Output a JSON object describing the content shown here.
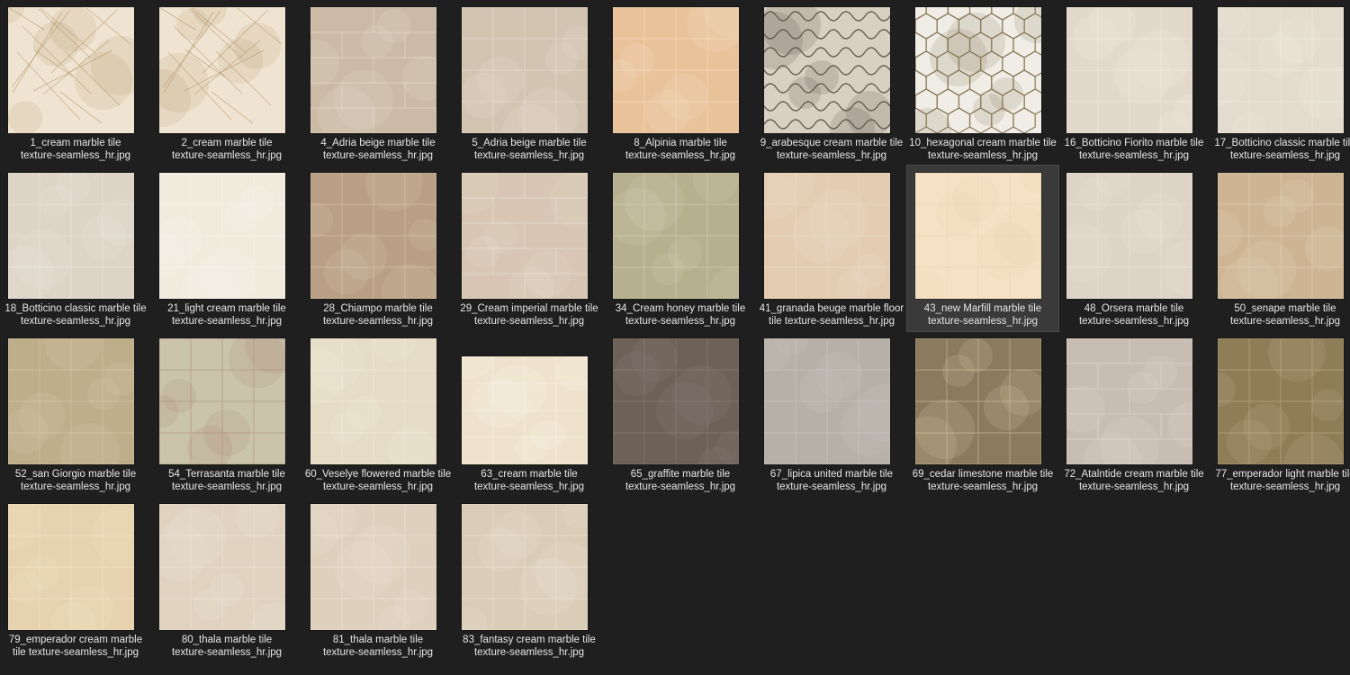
{
  "files": [
    {
      "line1": "1_cream marble tile",
      "line2": "texture-seamless_hr.jpg",
      "base": "#efe4d2",
      "vein": "#b99a6e",
      "pattern": "veins"
    },
    {
      "line1": "2_cream marble tile",
      "line2": "texture-seamless_hr.jpg",
      "base": "#efe4d2",
      "vein": "#b99a6e",
      "pattern": "veins"
    },
    {
      "line1": "4_Adria beige marble tile",
      "line2": "texture-seamless_hr.jpg",
      "base": "#cbbba6",
      "vein": "#e8ddd0",
      "pattern": "brick"
    },
    {
      "line1": "5_Adria beige marble tile",
      "line2": "texture-seamless_hr.jpg",
      "base": "#d2c4b1",
      "vein": "#ece2d6",
      "pattern": "grid"
    },
    {
      "line1": "8_Alpinia marble tile",
      "line2": "texture-seamless_hr.jpg",
      "base": "#e9c29a",
      "vein": "#f6e2cb",
      "pattern": "grid"
    },
    {
      "line1": "9_arabesque cream marble tile",
      "line2": "texture-seamless_hr.jpg",
      "base": "#d8d0c2",
      "vein": "#5a5346",
      "pattern": "arabesque"
    },
    {
      "line1": "10_hexagonal cream marble tile",
      "line2": "texture-seamless_hr.jpg",
      "base": "#f0ede6",
      "vein": "#8a7a5a",
      "pattern": "hex"
    },
    {
      "line1": "16_Botticino Fiorito marble tile",
      "line2": "texture-seamless_hr.jpg",
      "base": "#e2d9cb",
      "vein": "#f4eee5",
      "pattern": "grid"
    },
    {
      "line1": "17_Botticino classic marble tile",
      "line2": "texture-seamless_hr.jpg",
      "base": "#e3dbcd",
      "vein": "#f5efe6",
      "pattern": "grid"
    },
    {
      "line1": "18_Botticino classic marble tile",
      "line2": "texture-seamless_hr.jpg",
      "base": "#ddd4c6",
      "vein": "#f1ebe2",
      "pattern": "grid"
    },
    {
      "line1": "21_light cream marble tile",
      "line2": "texture-seamless_hr.jpg",
      "base": "#f1ebde",
      "vein": "#faf6ef",
      "pattern": "grid"
    },
    {
      "line1": "28_Chiampo marble tile",
      "line2": "texture-seamless_hr.jpg",
      "base": "#b99f86",
      "vein": "#dccbb8",
      "pattern": "grid"
    },
    {
      "line1": "29_Cream imperial marble tile",
      "line2": "texture-seamless_hr.jpg",
      "base": "#d6c6b3",
      "vein": "#ede3d7",
      "pattern": "brick"
    },
    {
      "line1": "34_Cream honey marble tile",
      "line2": "texture-seamless_hr.jpg",
      "base": "#b7b08e",
      "vein": "#d8d3bb",
      "pattern": "grid"
    },
    {
      "line1": "41_granada beuge marble floor",
      "line2": "tile texture-seamless_hr.jpg",
      "base": "#e3ccb2",
      "vein": "#efdfcd",
      "pattern": "grid"
    },
    {
      "line1": "43_new Marfill marble tile",
      "line2": "texture-seamless_hr.jpg",
      "base": "#f5e2c4",
      "vein": "#e9d3b1",
      "pattern": "grid"
    },
    {
      "line1": "48_Orsera marble tile",
      "line2": "texture-seamless_hr.jpg",
      "base": "#ddd3c6",
      "vein": "#eee7de",
      "pattern": "grid"
    },
    {
      "line1": "50_senape marble tile",
      "line2": "texture-seamless_hr.jpg",
      "base": "#cdb593",
      "vein": "#e6d6bf",
      "pattern": "grid"
    },
    {
      "line1": "52_san Giorgio marble tile",
      "line2": "texture-seamless_hr.jpg",
      "base": "#bfae8a",
      "vein": "#d8cbb0",
      "pattern": "grid"
    },
    {
      "line1": "54_Terrasanta marble tile",
      "line2": "texture-seamless_hr.jpg",
      "base": "#c9c4aa",
      "vein": "#b08878",
      "pattern": "grid"
    },
    {
      "line1": "60_Veselye flowered marble tile",
      "line2": "texture-seamless_hr.jpg",
      "base": "#e6dcc6",
      "vein": "#f2ecdf",
      "pattern": "grid"
    },
    {
      "line1": "63_cream marble tile",
      "line2": "texture-seamless_hr.jpg",
      "base": "#eee2cc",
      "vein": "#fbf7ef",
      "pattern": "grid"
    },
    {
      "line1": "65_graffite marble tile",
      "line2": "texture-seamless_hr.jpg",
      "base": "#6e6258",
      "vein": "#8c8279",
      "pattern": "grid"
    },
    {
      "line1": "67_lipica united marble tile",
      "line2": "texture-seamless_hr.jpg",
      "base": "#b6b0a8",
      "vein": "#cfcac3",
      "pattern": "grid"
    },
    {
      "line1": "69_cedar limestone marble tile",
      "line2": "texture-seamless_hr.jpg",
      "base": "#8c7a5e",
      "vein": "#d8c7a6",
      "pattern": "grid"
    },
    {
      "line1": "72_Atalntide cream marble tile",
      "line2": "texture-seamless_hr.jpg",
      "base": "#c8bdb3",
      "vein": "#e1d9d1",
      "pattern": "brick"
    },
    {
      "line1": "77_emperador light marble tile",
      "line2": "texture-seamless_hr.jpg",
      "base": "#8f7d58",
      "vein": "#c4b48e",
      "pattern": "grid"
    },
    {
      "line1": "79_emperador cream marble",
      "line2": "tile texture-seamless_hr.jpg",
      "base": "#e6d2ae",
      "vein": "#f4e7cf",
      "pattern": "grid"
    },
    {
      "line1": "80_thala marble tile",
      "line2": "texture-seamless_hr.jpg",
      "base": "#e0d2bf",
      "vein": "#f0e7db",
      "pattern": "grid"
    },
    {
      "line1": "81_thala marble tile",
      "line2": "texture-seamless_hr.jpg",
      "base": "#dfd0bd",
      "vein": "#efe6da",
      "pattern": "grid"
    },
    {
      "line1": "83_fantasy cream marble tile",
      "line2": "texture-seamless_hr.jpg",
      "base": "#d9cdb8",
      "vein": "#efe6d6",
      "pattern": "grid"
    }
  ]
}
